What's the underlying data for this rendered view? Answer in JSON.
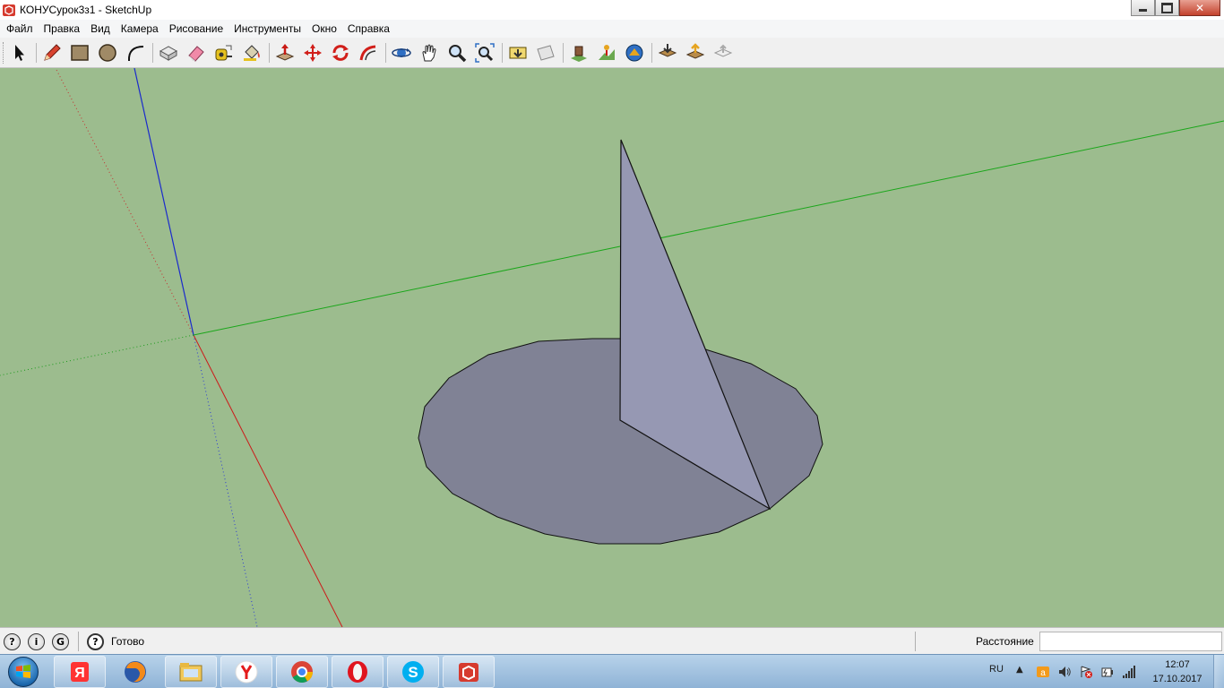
{
  "window": {
    "title": "КОНУСурок3з1 - SketchUp",
    "icon": "sketchup-logo-icon"
  },
  "menu": [
    "Файл",
    "Правка",
    "Вид",
    "Камера",
    "Рисование",
    "Инструменты",
    "Окно",
    "Справка"
  ],
  "toolbar": {
    "tools": [
      "select-tool-icon",
      "pencil-tool-icon",
      "rectangle-tool-icon",
      "circle-tool-icon",
      "arc-tool-icon",
      "make-component-icon",
      "eraser-tool-icon",
      "tape-measure-icon",
      "paint-bucket-icon",
      "push-pull-icon",
      "move-tool-icon",
      "rotate-tool-icon",
      "follow-me-icon",
      "orbit-tool-icon",
      "pan-tool-icon",
      "zoom-tool-icon",
      "zoom-extents-icon",
      "previous-view-icon",
      "next-view-icon",
      "add-location-icon",
      "toggle-terrain-icon",
      "photo-textures-icon",
      "get-models-icon",
      "share-model-icon",
      "share-component-icon"
    ]
  },
  "viewport": {
    "background_color": "#9cbc8e",
    "face_color_base": "#808295",
    "face_color_triangle": "#9698b3"
  },
  "statusbar": {
    "status_text": "Готово",
    "measure_label": "Расстояние",
    "measure_value": ""
  },
  "taskbar": {
    "apps": [
      "yandex-icon",
      "firefox-icon",
      "file-explorer-icon",
      "yandex-browser-icon",
      "chrome-icon",
      "opera-icon",
      "skype-icon",
      "sketchup-icon"
    ],
    "language": "RU",
    "clock_time": "12:07",
    "clock_date": "17.10.2017"
  }
}
